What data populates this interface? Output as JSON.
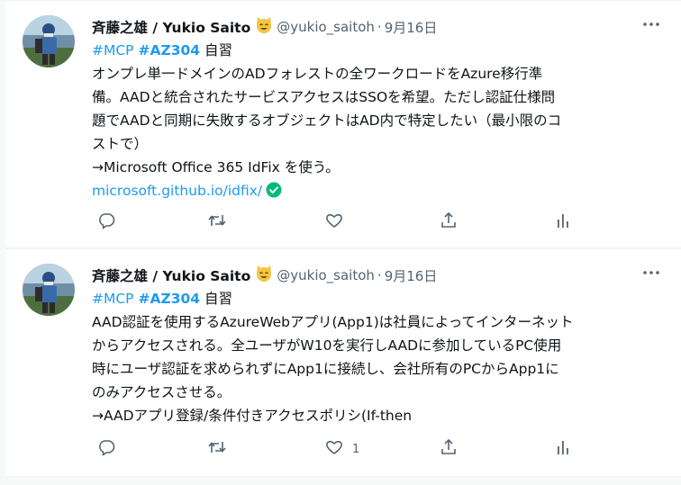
{
  "tweets": [
    {
      "author_name": "斉藤之雄 / Yukio Saito",
      "handle": "@yukio_saitoh",
      "separator": "·",
      "date": "9月16日",
      "tag_mcp": "#MCP",
      "tag_az304": "#AZ304",
      "tag_suffix": " 自習",
      "lines": [
        "オンプレ単一ドメインのADフォレストの全ワークロードをAzure移行準",
        "備。AADと統合されたサービスアクセスはSSOを希望。ただし認証仕様問",
        "題でAADと同期に失敗するオブジェクトはAD内で特定したい（最小限のコ",
        "ストで）",
        "→Microsoft Office 365 IdFix を使う。"
      ],
      "link_text": "microsoft.github.io/idfix/",
      "actions": {
        "reply": "",
        "retweet": "",
        "like": "",
        "share": "",
        "analytics": ""
      }
    },
    {
      "author_name": "斉藤之雄 / Yukio Saito",
      "handle": "@yukio_saitoh",
      "separator": "·",
      "date": "9月16日",
      "tag_mcp": "#MCP",
      "tag_az304": "#AZ304",
      "tag_suffix": " 自習",
      "lines": [
        "AAD認証を使用するAzureWebアプリ(App1)は社員によってインターネット",
        "からアクセスされる。全ユーザがW10を実行しAADに参加しているPC使用",
        "時にユーザ認証を求められずにApp1に接続し、会社所有のPCからApp1に",
        "のみアクセスさせる。",
        "→AADアプリ登録/条件付きアクセスポリシ(If-then"
      ],
      "actions": {
        "reply": "",
        "retweet": "",
        "like": "1",
        "share": "",
        "analytics": ""
      }
    }
  ],
  "colors": {
    "accent": "#1d9bf0",
    "text": "#0f1419",
    "muted": "#536471",
    "verified": "#00ba7c",
    "background": "#f7f9f9"
  },
  "icons": {
    "emoji": "smiling-cat-emoji",
    "verified": "green-check-icon",
    "reply": "reply-icon",
    "retweet": "retweet-icon",
    "like": "heart-icon",
    "share": "share-icon",
    "analytics": "analytics-icon",
    "more": "more-icon"
  }
}
